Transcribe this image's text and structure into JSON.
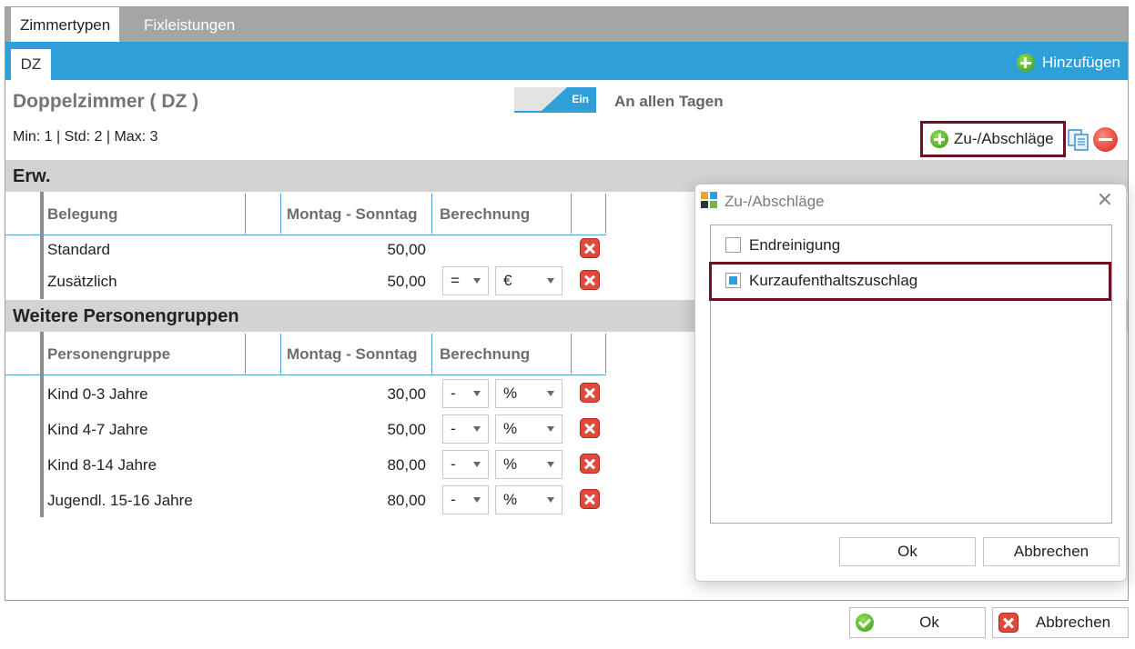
{
  "tabs": [
    {
      "label": "Zimmertypen",
      "active": true
    },
    {
      "label": "Fixleistungen",
      "active": false
    }
  ],
  "subtab": {
    "label": "DZ"
  },
  "add_button": {
    "label": "Hinzufügen",
    "icon": "plus-circle-icon"
  },
  "room": {
    "title": "Doppelzimmer  ( DZ )",
    "minmax": "Min:  1  |  Std:  2  |  Max:  3"
  },
  "toggle": {
    "state": "Ein",
    "days": "An allen Tagen"
  },
  "surcharge_button": {
    "label": "Zu-/Abschläge"
  },
  "adults": {
    "section_title": "Erw.",
    "headers": {
      "col1": "Belegung",
      "col2": "Montag - Sonntag",
      "col3": "Berechnung"
    },
    "rows": [
      {
        "label": "Standard",
        "value": "50,00",
        "op": "",
        "unit": ""
      },
      {
        "label": "Zusätzlich",
        "value": "50,00",
        "op": "=",
        "unit": "€"
      }
    ]
  },
  "groups": {
    "section_title": "Weitere Personengruppen",
    "headers": {
      "col1": "Personengruppe",
      "col2": "Montag - Sonntag",
      "col3": "Berechnung"
    },
    "rows": [
      {
        "label": "Kind 0-3 Jahre",
        "value": "30,00",
        "op": "-",
        "unit": "%"
      },
      {
        "label": "Kind 4-7 Jahre",
        "value": "50,00",
        "op": "-",
        "unit": "%"
      },
      {
        "label": "Kind 8-14 Jahre",
        "value": "80,00",
        "op": "-",
        "unit": "%"
      },
      {
        "label": "Jugendl. 15-16 Jahre",
        "value": "80,00",
        "op": "-",
        "unit": "%"
      }
    ]
  },
  "dialog": {
    "title": "Zu-/Abschläge",
    "items": [
      {
        "label": "Endreinigung",
        "checked": false
      },
      {
        "label": "Kurzaufenthaltszuschlag",
        "checked": true
      }
    ],
    "ok_label": "Ok",
    "cancel_label": "Abbrechen"
  },
  "footer": {
    "ok_label": "Ok",
    "cancel_label": "Abbrechen"
  },
  "colors": {
    "accent": "#2e9fd8",
    "tabbar": "#a5a5a5",
    "highlight_border": "#6d1222",
    "section": "#d3d3d3"
  }
}
